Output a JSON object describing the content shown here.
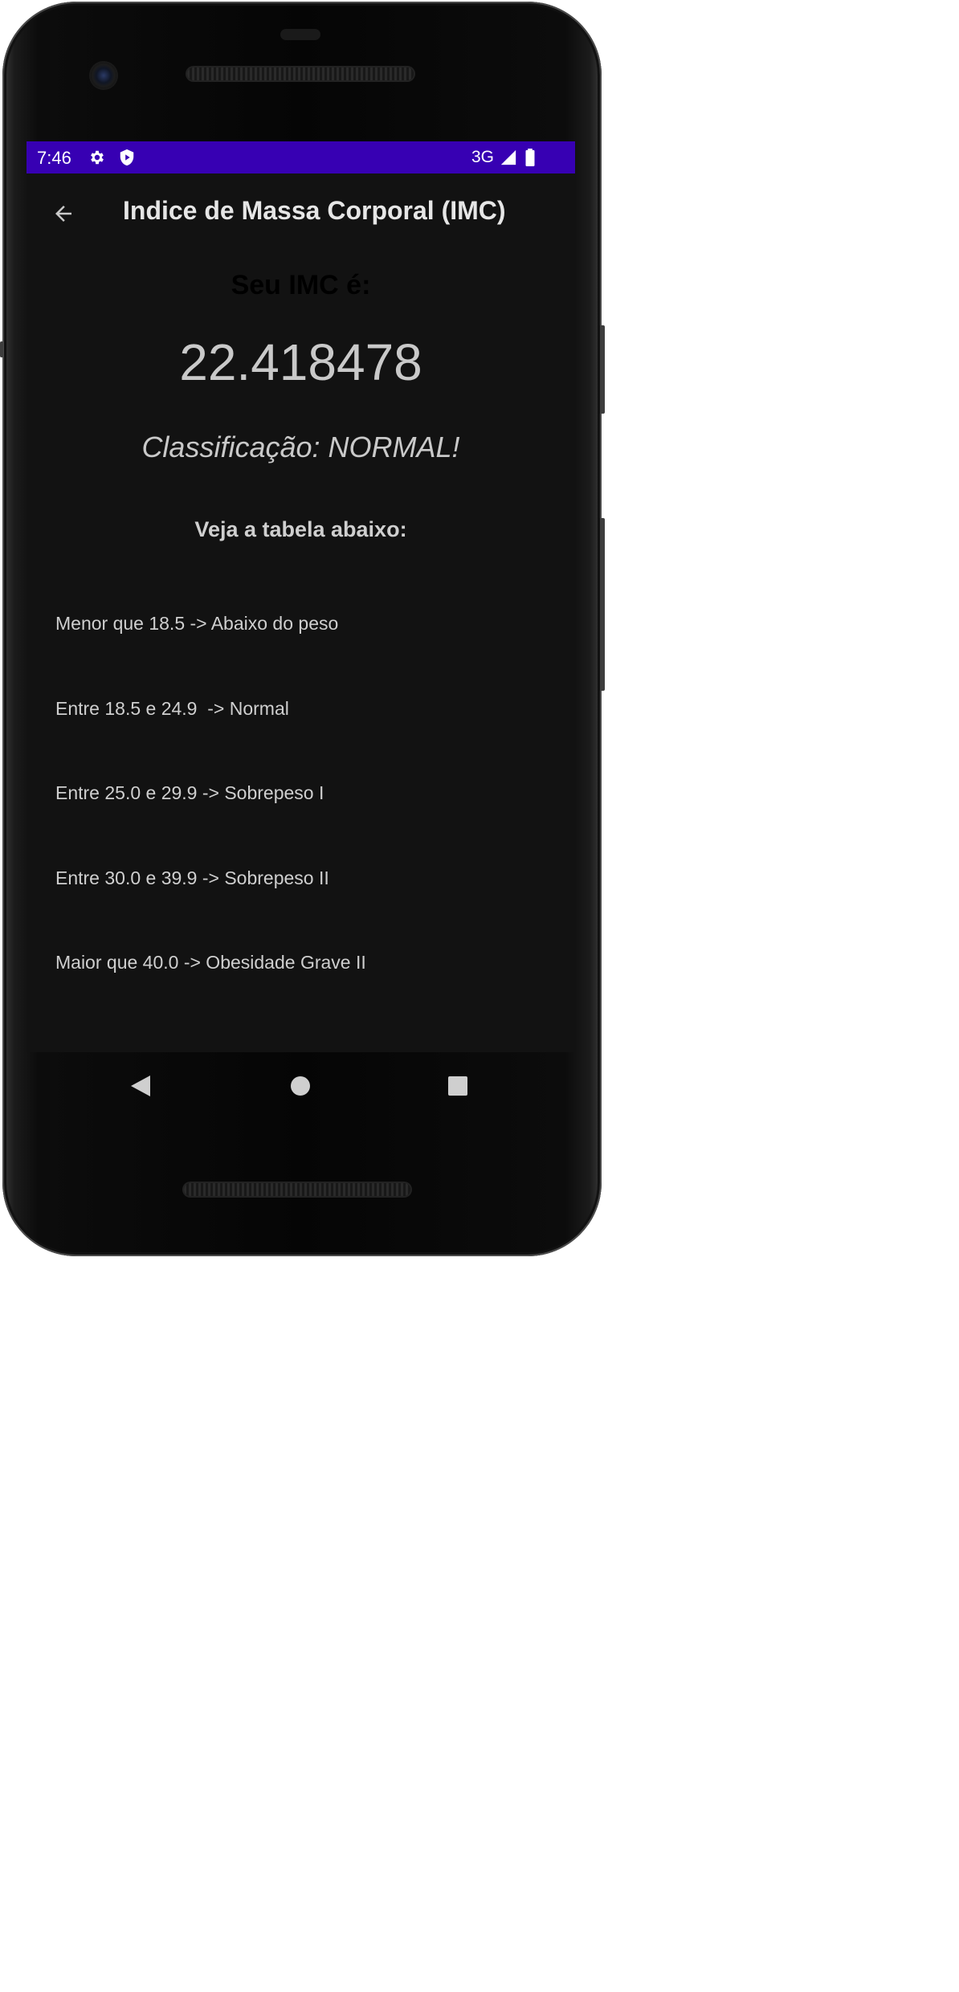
{
  "status_bar": {
    "time": "7:46",
    "network": "3G",
    "background_color": "#3700b3",
    "icons": [
      "settings-icon",
      "shield-play-icon",
      "signal-icon",
      "battery-icon"
    ]
  },
  "app_bar": {
    "title": "Indice de Massa Corporal (IMC)",
    "back_icon": "arrow-back-icon"
  },
  "result": {
    "heading": "Seu IMC é:",
    "value": "22.418478",
    "classification": "Classificação: NORMAL!"
  },
  "table": {
    "heading": "Veja a tabela abaixo:",
    "rows": [
      "Menor que 18.5 -> Abaixo do peso",
      "Entre 18.5 e 24.9  -> Normal",
      "Entre 25.0 e 29.9 -> Sobrepeso I",
      "Entre 30.0 e 39.9 -> Sobrepeso II",
      "Maior que 40.0 -> Obesidade Grave II"
    ]
  },
  "nav_bar": {
    "icons": [
      "back-triangle-icon",
      "home-circle-icon",
      "recents-square-icon"
    ]
  },
  "colors": {
    "screen_background": "#121212",
    "text_primary": "#c9c9c9",
    "heading_dark": "#000000"
  }
}
